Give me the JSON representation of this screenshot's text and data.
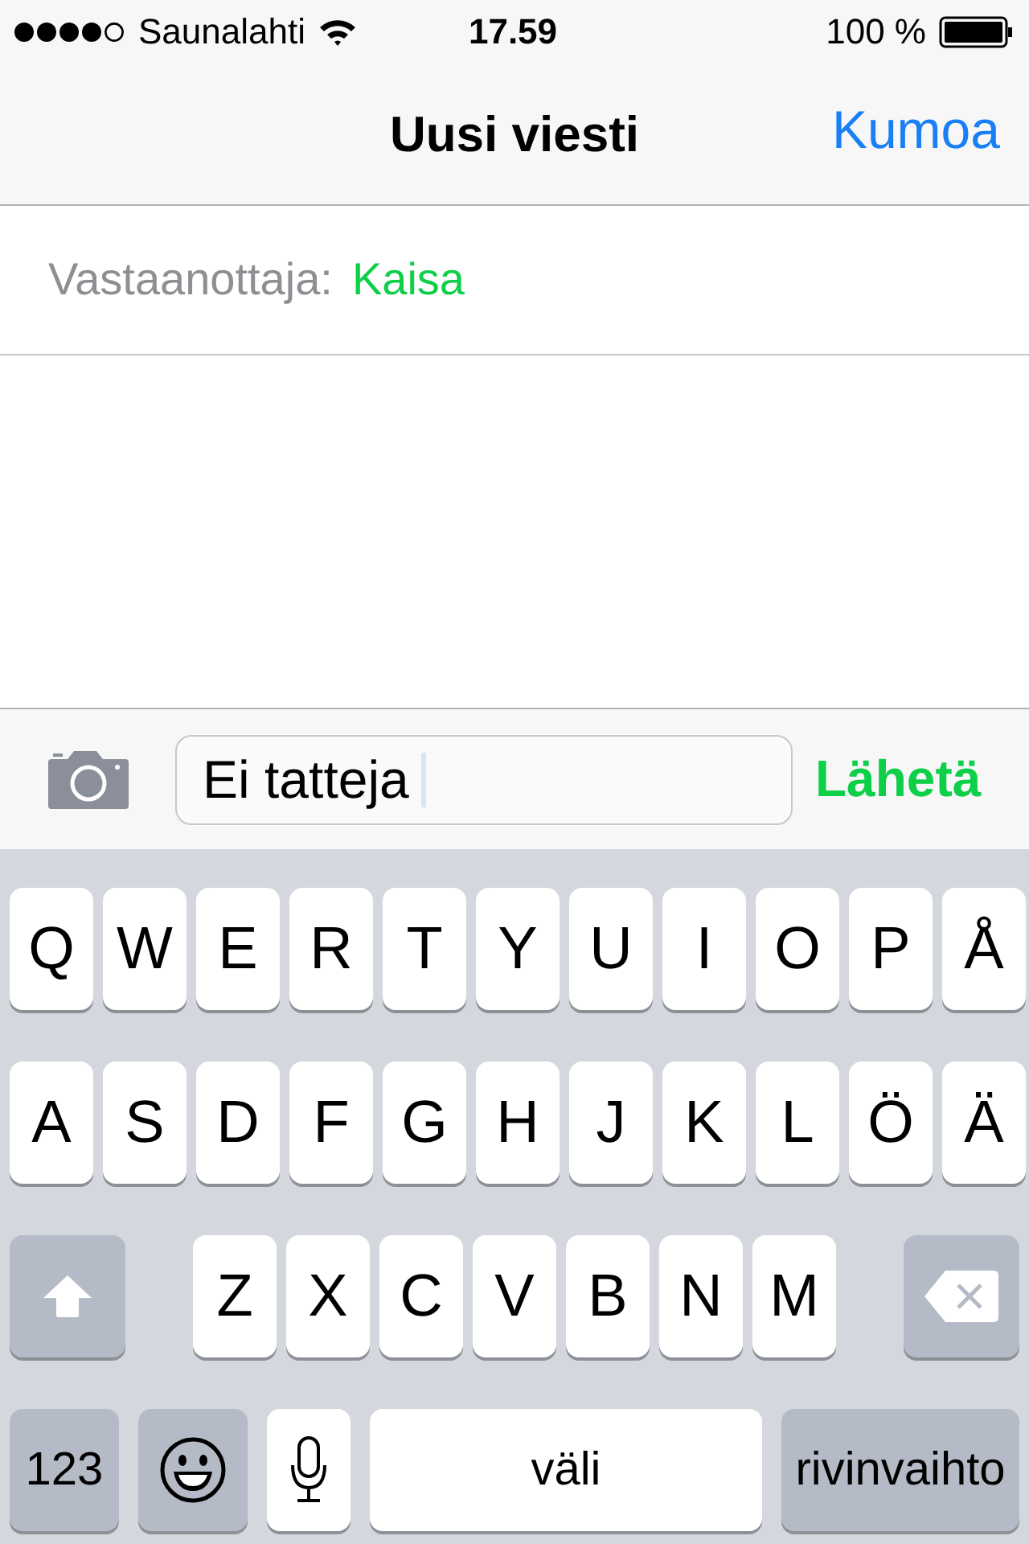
{
  "status_bar": {
    "carrier": "Saunalahti",
    "time": "17.59",
    "battery": "100 %"
  },
  "nav_bar": {
    "title": "Uusi viesti",
    "cancel": "Kumoa"
  },
  "recipient": {
    "label": "Vastaanottaja:",
    "name": "Kaisa"
  },
  "compose": {
    "value": "Ei tatteja",
    "send": "Lähetä"
  },
  "keyboard": {
    "letter_rows": [
      {
        "keys": [
          "Q",
          "W",
          "E",
          "R",
          "T",
          "Y",
          "U",
          "I",
          "O",
          "P",
          "Å"
        ]
      },
      {
        "keys": [
          "A",
          "S",
          "D",
          "F",
          "G",
          "H",
          "J",
          "K",
          "L",
          "Ö",
          "Ä"
        ]
      },
      {
        "keys": [
          "Z",
          "X",
          "C",
          "V",
          "B",
          "N",
          "M"
        ],
        "left_key": {
          "kind": "shift"
        },
        "right_key": {
          "kind": "backspace"
        }
      }
    ],
    "bottom_row": [
      {
        "kind": "numbers",
        "label": "123"
      },
      {
        "kind": "emoji"
      },
      {
        "kind": "mic"
      },
      {
        "kind": "space",
        "label": "väli"
      },
      {
        "kind": "return",
        "label": "rivinvaihto"
      }
    ]
  }
}
